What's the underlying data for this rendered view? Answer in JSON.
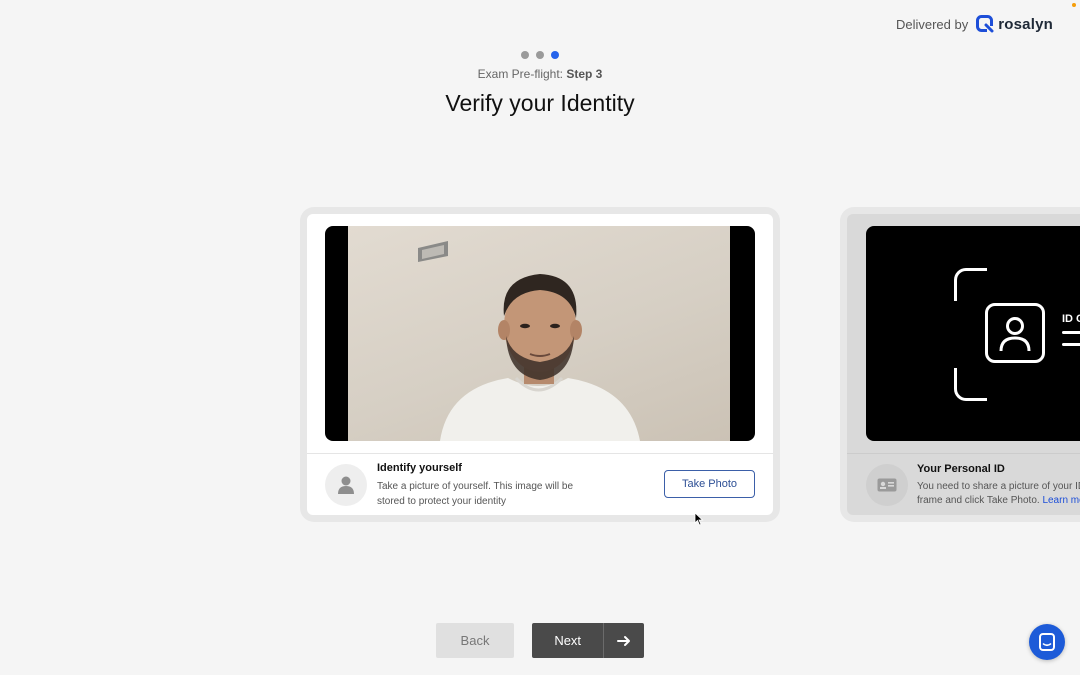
{
  "brand": {
    "delivered_by": "Delivered by",
    "name": "rosalyn",
    "logo_icon": "rosalyn-logo-icon",
    "accent": "#1d4ed8"
  },
  "stepper": {
    "steps_total": 3,
    "current_step": 3,
    "caption_prefix": "Exam Pre-flight:",
    "caption_step": "Step 3",
    "active_color": "#2563eb"
  },
  "title": "Verify your Identity",
  "identify_card": {
    "camera_feed": "webcam-preview",
    "avatar_icon": "user-icon",
    "title": "Identify yourself",
    "description": "Take a picture of yourself. This image will be stored to protect your identity",
    "button_label": "Take Photo"
  },
  "id_card": {
    "screen_icon": "id-card-frame-icon",
    "screen_text": "ID C",
    "avatar_icon": "id-badge-icon",
    "title": "Your Personal ID",
    "description_line1": "You need to share a picture of your ID",
    "description_line2": "frame and click Take Photo.",
    "learn_more": "Learn mo"
  },
  "footer": {
    "back_label": "Back",
    "next_label": "Next",
    "next_icon": "arrow-right-icon"
  },
  "chat": {
    "icon": "chat-icon",
    "color": "#1d5bd8"
  }
}
